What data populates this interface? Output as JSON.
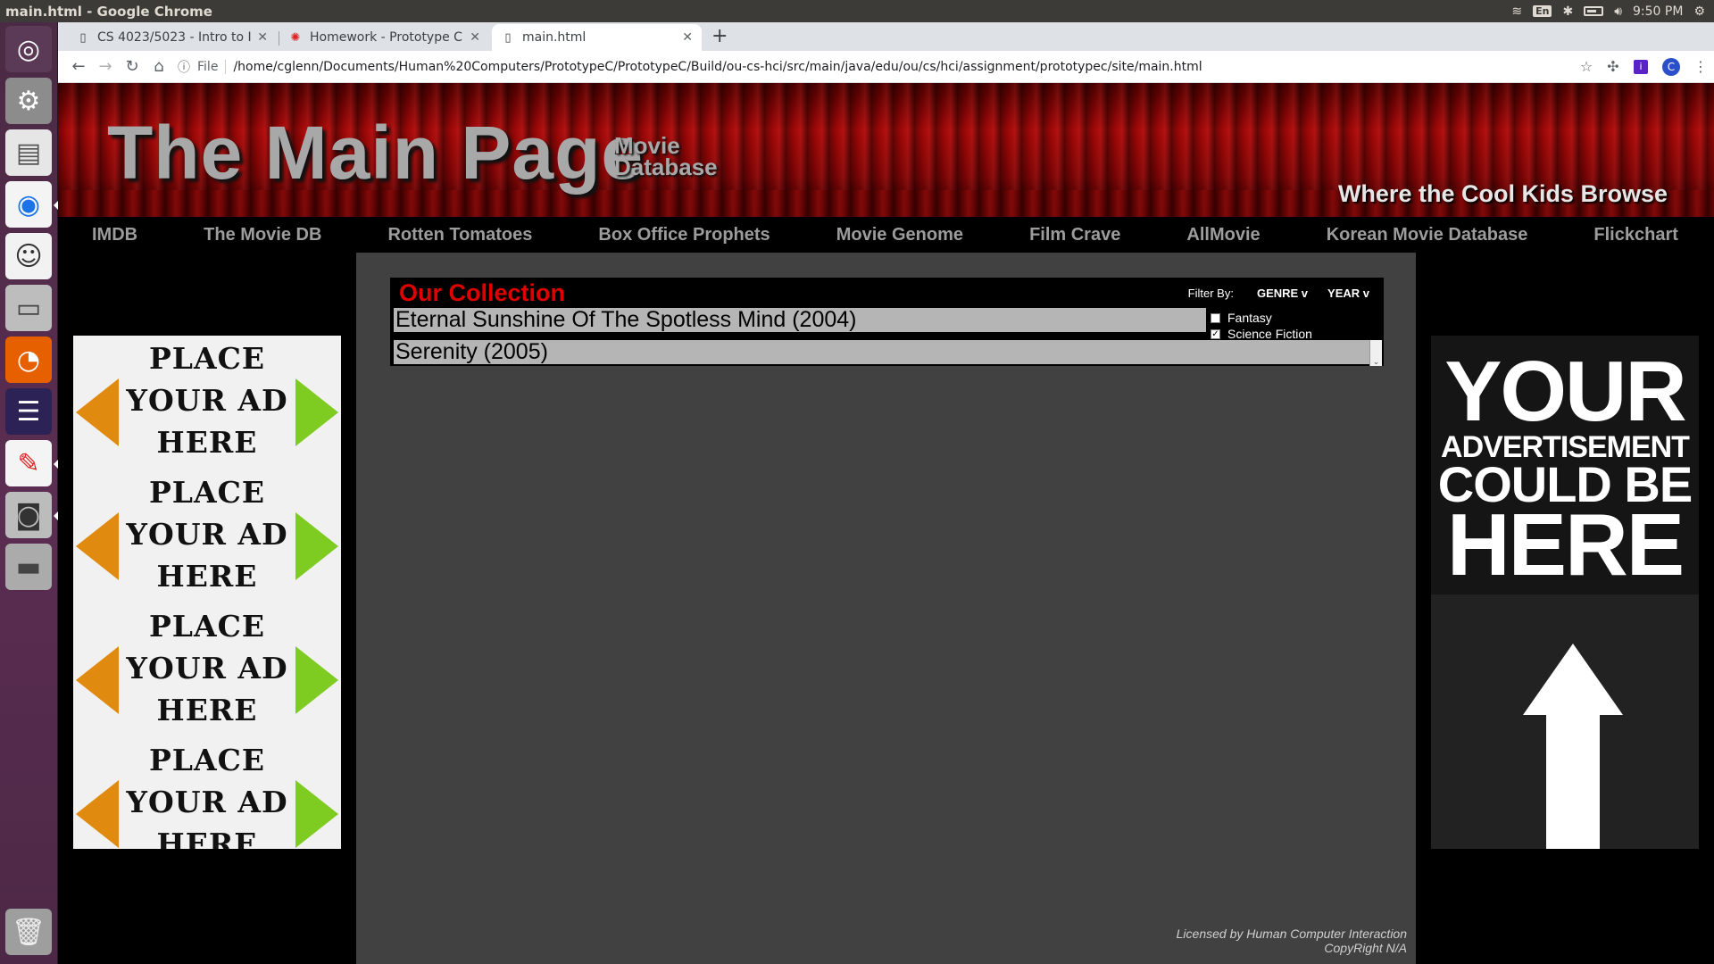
{
  "os": {
    "window_title": "main.html - Google Chrome",
    "lang": "En",
    "clock": "9:50 PM"
  },
  "browser": {
    "tabs": [
      {
        "label": "CS 4023/5023 - Intro to Int"
      },
      {
        "label": "Homework - Prototype C"
      },
      {
        "label": "main.html"
      }
    ],
    "scheme": "File",
    "url": "/home/cglenn/Documents/Human%20Computers/PrototypeC/PrototypeC/Build/ou-cs-hci/src/main/java/edu/ou/cs/hci/assignment/prototypec/site/main.html",
    "profile_initial": "C",
    "ext_label": "i"
  },
  "site": {
    "title": "The Main Page",
    "subtitle_1": "Movie",
    "subtitle_2": "Database",
    "tagline": "Where the Cool Kids Browse",
    "nav": [
      "IMDB",
      "The Movie DB",
      "Rotten Tomatoes",
      "Box Office Prophets",
      "Movie Genome",
      "Film Crave",
      "AllMovie",
      "Korean Movie Database",
      "Flickchart"
    ]
  },
  "collection": {
    "title": "Our Collection",
    "filter_by": "Filter By:",
    "genre_label": "GENRE v",
    "year_label": "YEAR v",
    "movies": [
      "Eternal Sunshine Of The Spotless Mind (2004)",
      "Serenity (2005)"
    ],
    "genres": [
      {
        "label": "Fantasy",
        "checked": false
      },
      {
        "label": "Science Fiction",
        "checked": true
      }
    ]
  },
  "ads": {
    "left_line_1": "PLACE",
    "left_line_2": "YOUR AD",
    "left_line_3": "HERE",
    "right_line_1": "YOUR",
    "right_line_2": "ADVERTISEMENT",
    "right_line_3": "COULD BE",
    "right_line_4": "HERE"
  },
  "footer": {
    "line_1": "Licensed by Human Computer Interaction",
    "line_2": "CopyRight N/A"
  }
}
